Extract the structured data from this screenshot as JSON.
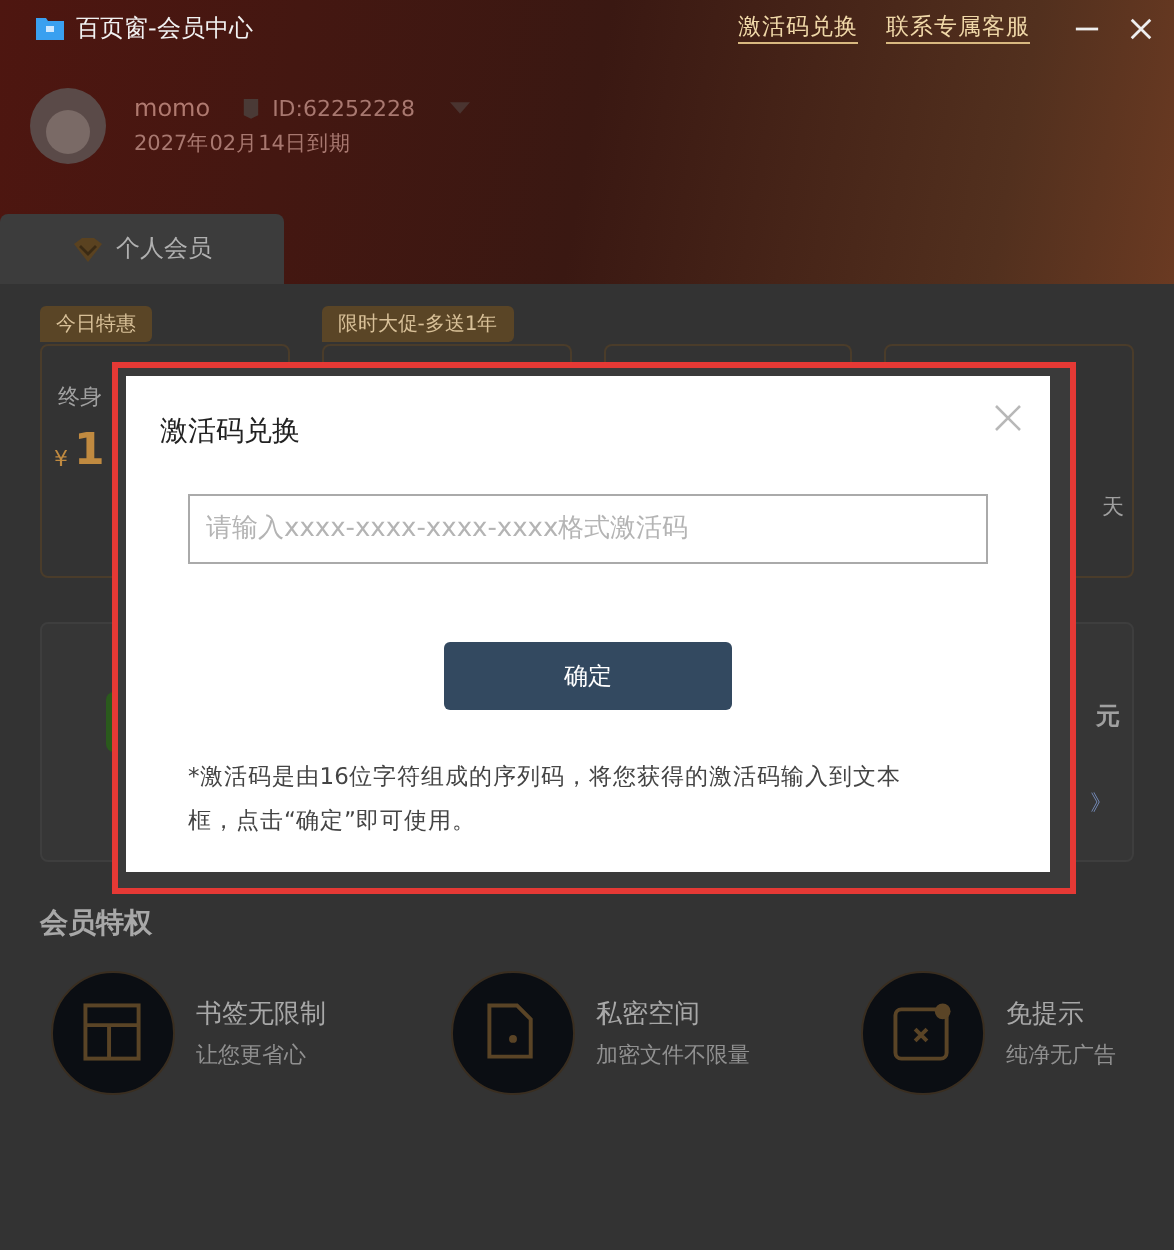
{
  "window": {
    "title": "百页窗-会员中心",
    "links": [
      "激活码兑换",
      "联系专属客服"
    ]
  },
  "user": {
    "name": "momo",
    "id": "ID:62252228",
    "expiry": "2027年02月14日到期"
  },
  "tabs": [
    {
      "label": "个人会员",
      "selected": true
    }
  ],
  "plans": [
    {
      "kind": "plan",
      "badge": "今日特惠",
      "title": "终身",
      "currency": "¥",
      "amount": "1"
    },
    {
      "kind": "plan",
      "badge": "限时大促-多送1年"
    },
    {
      "kind": "plan"
    },
    {
      "kind": "plan",
      "side_text": "天"
    }
  ],
  "promo": {
    "price_fragment": "元",
    "link_fragment": "》"
  },
  "perks_title": "会员特权",
  "perks": [
    {
      "kind": "bookmark",
      "title": "书签无限制",
      "subtitle": "让您更省心"
    },
    {
      "kind": "folder",
      "title": "私密空间",
      "subtitle": "加密文件不限量"
    },
    {
      "kind": "popup",
      "title": "免提示",
      "subtitle": "纯净无广告"
    }
  ],
  "dialog": {
    "title": "激活码兑换",
    "placeholder": "请输入xxxx-xxxx-xxxx-xxxx格式激活码",
    "button": "确定",
    "note": "*激活码是由16位字符组成的序列码，将您获得的激活码输入到文本框，点击“确定”即可使用。"
  }
}
